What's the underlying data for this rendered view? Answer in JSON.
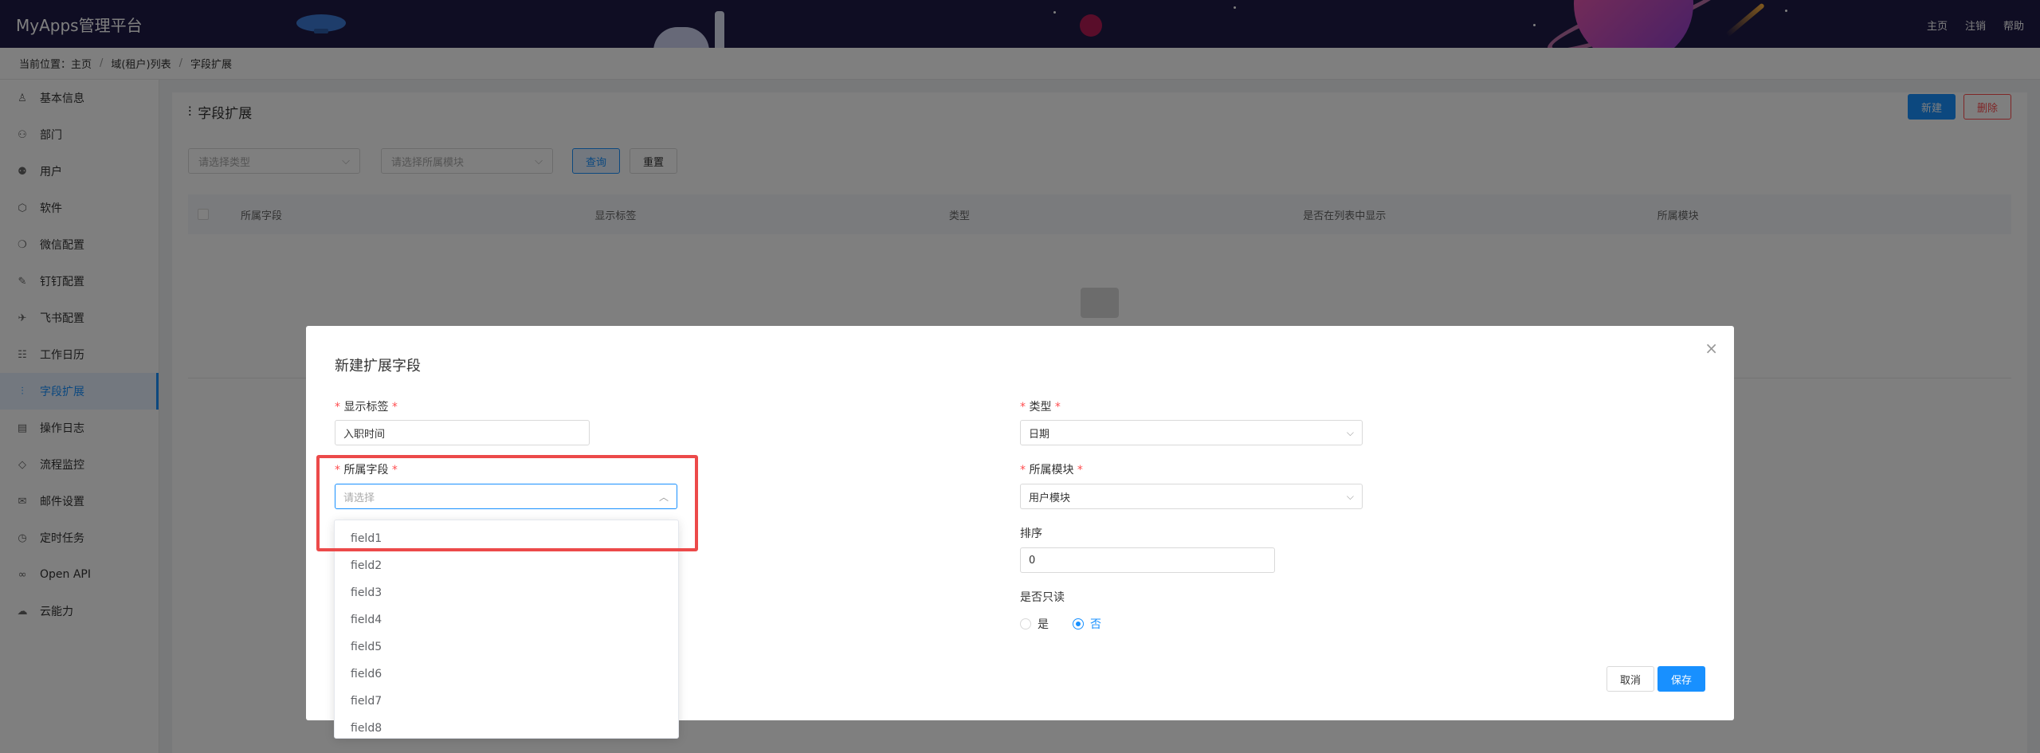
{
  "app": {
    "title": "MyApps管理平台"
  },
  "header_nav": [
    "主页",
    "注销",
    "帮助"
  ],
  "breadcrumb": {
    "prefix": "当前位置：",
    "items": [
      "主页",
      "域(租户)列表",
      "字段扩展"
    ]
  },
  "sidebar": {
    "items": [
      {
        "label": "基本信息",
        "icon": "user-icon"
      },
      {
        "label": "部门",
        "icon": "org-icon"
      },
      {
        "label": "用户",
        "icon": "users-icon"
      },
      {
        "label": "软件",
        "icon": "cube-icon"
      },
      {
        "label": "微信配置",
        "icon": "wechat-icon"
      },
      {
        "label": "钉钉配置",
        "icon": "dingtalk-icon"
      },
      {
        "label": "飞书配置",
        "icon": "feishu-icon"
      },
      {
        "label": "工作日历",
        "icon": "calendar-icon"
      },
      {
        "label": "字段扩展",
        "icon": "sliders-icon",
        "active": true
      },
      {
        "label": "操作日志",
        "icon": "log-icon"
      },
      {
        "label": "流程监控",
        "icon": "flow-icon"
      },
      {
        "label": "邮件设置",
        "icon": "mail-icon"
      },
      {
        "label": "定时任务",
        "icon": "clock-icon"
      },
      {
        "label": "Open API",
        "icon": "link-icon"
      },
      {
        "label": "云能力",
        "icon": "cloud-icon"
      }
    ]
  },
  "page": {
    "title": "字段扩展",
    "new_label": "新建",
    "delete_label": "删除",
    "filter_type_placeholder": "请选择类型",
    "filter_module_placeholder": "请选择所属模块",
    "query_label": "查询",
    "reset_label": "重置",
    "table_headers": [
      "所属字段",
      "显示标签",
      "类型",
      "是否在列表中显示",
      "所属模块"
    ]
  },
  "dialog": {
    "title": "新建扩展字段",
    "display_label": {
      "label": "显示标签",
      "value": "入职时间"
    },
    "field": {
      "label": "所属字段",
      "placeholder": "请选择"
    },
    "type": {
      "label": "类型",
      "value": "日期"
    },
    "module": {
      "label": "所属模块",
      "value": "用户模块"
    },
    "sort": {
      "label": "排序",
      "value": "0"
    },
    "readonly": {
      "label": "是否只读",
      "options": [
        "是",
        "否"
      ],
      "selected": "否"
    },
    "cancel_label": "取消",
    "save_label": "保存"
  },
  "dropdown": {
    "options": [
      "field1",
      "field2",
      "field3",
      "field4",
      "field5",
      "field6",
      "field7",
      "field8"
    ]
  },
  "colors": {
    "primary": "#1890ff",
    "header_bg": "#1e1a47",
    "danger": "#ff4d4f",
    "highlight": "#ec4a4a"
  }
}
